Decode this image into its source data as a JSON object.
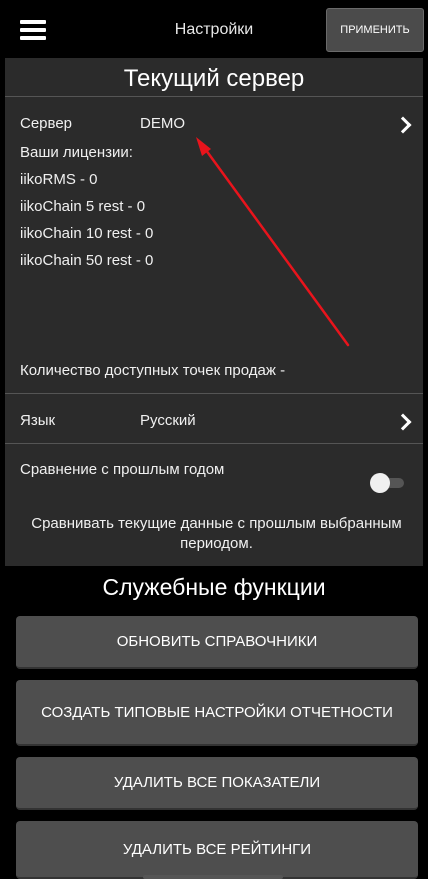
{
  "header": {
    "title": "Настройки",
    "apply_label": "ПРИМЕНИТЬ"
  },
  "current_server": {
    "section_title": "Текущий сервер",
    "server_label": "Сервер",
    "server_value": "DEMO",
    "licenses_label": "Ваши лицензии:",
    "licenses": [
      "iikoRMS - 0",
      "iikoChain 5 rest - 0",
      "iikoChain 10 rest - 0",
      "iikoChain 50 rest - 0"
    ],
    "points_of_sale": "Количество доступных точек продаж -",
    "language_label": "Язык",
    "language_value": "Русский",
    "compare_label": "Сравнение с прошлым годом",
    "compare_enabled": false,
    "compare_description": "Сравнивать текущие данные с прошлым выбранным периодом."
  },
  "service": {
    "section_title": "Служебные функции",
    "buttons": [
      "ОБНОВИТЬ СПРАВОЧНИКИ",
      "СОЗДАТЬ ТИПОВЫЕ НАСТРОЙКИ ОТЧЕТНОСТИ",
      "УДАЛИТЬ ВСЕ ПОКАЗАТЕЛИ",
      "УДАЛИТЬ ВСЕ РЕЙТИНГИ"
    ]
  },
  "colors": {
    "annotation_arrow": "#e8141c",
    "panel_bg": "#2b2b2b",
    "button_bg": "#4e4e4e"
  }
}
